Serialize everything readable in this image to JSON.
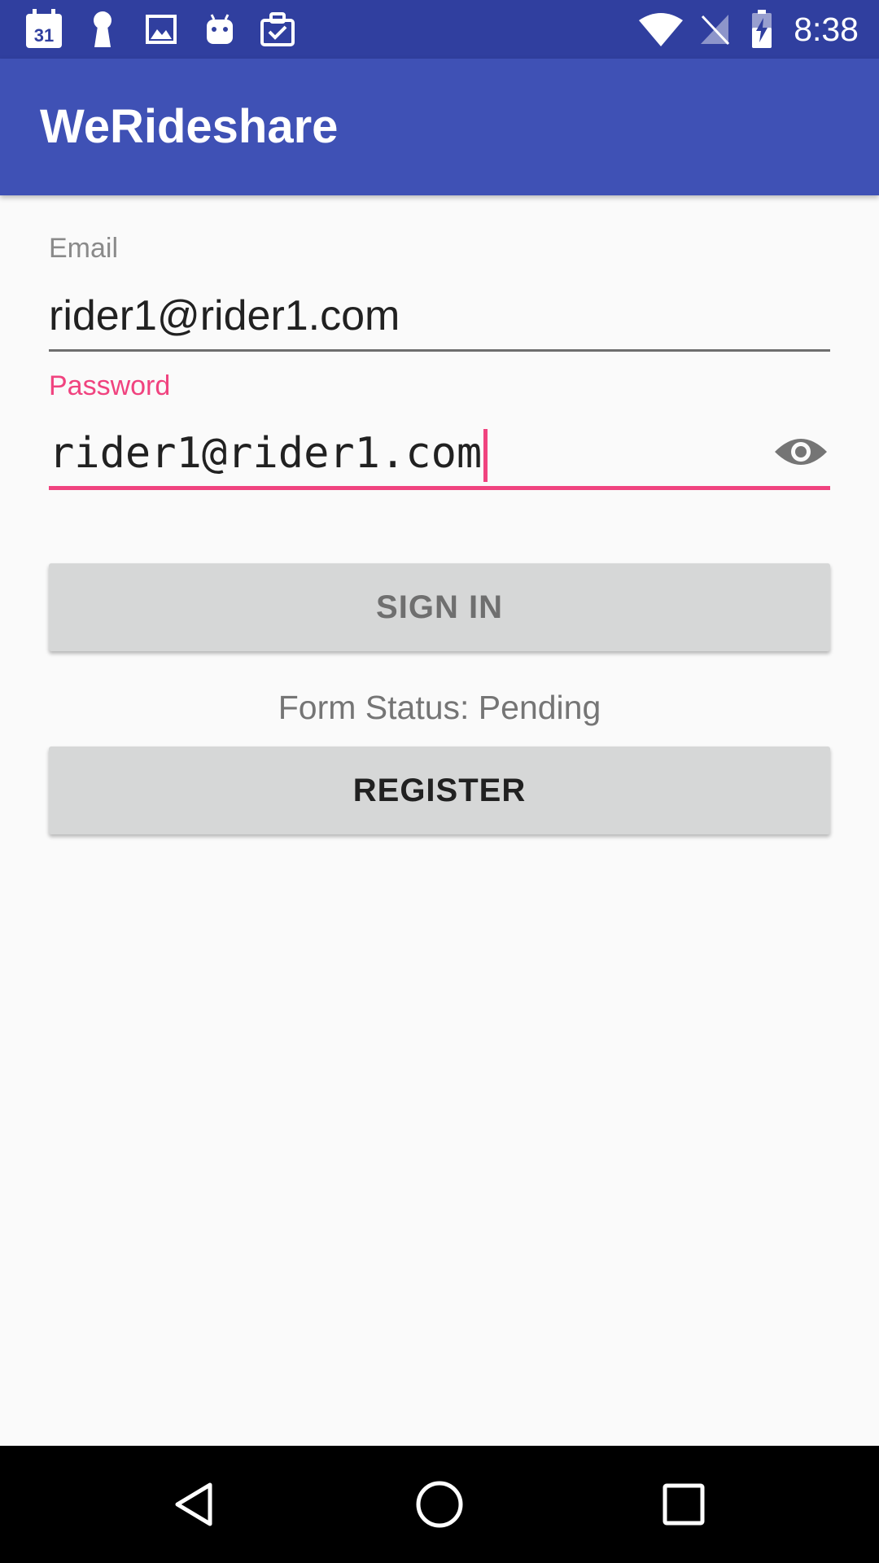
{
  "status_bar": {
    "time": "8:38",
    "calendar_day": "31",
    "icons": [
      "calendar-icon",
      "keyhole-icon",
      "image-icon",
      "android-icon",
      "clipboard-check-icon",
      "wifi-icon",
      "no-signal-icon",
      "battery-charging-icon"
    ]
  },
  "app_bar": {
    "title": "WeRideshare"
  },
  "form": {
    "email_label": "Email",
    "email_value": "rider1@rider1.com",
    "password_label": "Password",
    "password_value": "rider1@rider1.com",
    "password_toggle_icon": "eye-icon",
    "sign_in_label": "SIGN IN",
    "status_text": "Form Status: Pending",
    "register_label": "REGISTER"
  },
  "colors": {
    "status_bar": "#303f9f",
    "app_bar": "#3f51b5",
    "accent": "#f0437f",
    "button": "#d6d7d7"
  },
  "nav_bar": {
    "icons": [
      "back-icon",
      "home-icon",
      "recents-icon"
    ]
  }
}
